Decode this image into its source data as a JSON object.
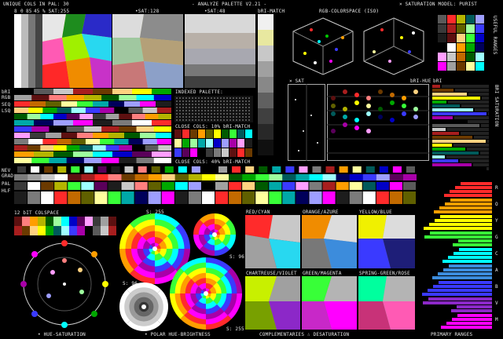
{
  "header": {
    "left": "UNIQUE COLS IN PAL: 30",
    "title": "- ANALYZE PALETTE V2.21 -",
    "right": "× SATURATION MODEL: PURIST"
  },
  "sat_labels": [
    "% SAT:255",
    "•SAT:128",
    "•SAT:48",
    "bRI-MATCH"
  ],
  "small_cols": [
    "8",
    "0",
    "85",
    "45"
  ],
  "rgb_title": "RGB-COLORSPACE (ISO)",
  "side_titles": {
    "useful_ranges": "USEFUL RANGES",
    "saturation": "BRI SATURATION"
  },
  "left_labels": {
    "bri": "bRI",
    "rgb": "RGB",
    "seq": "SEQ",
    "lsq": "LSQ",
    "nev": "NEV",
    "grad": "GRAD",
    "pal": "PAL",
    "hlf": "HLF"
  },
  "indexed_title": "INDEXED PALETTE:",
  "close10_title": "CLOSE COLS: 10% bRI-MATCH",
  "close40_title": "CLOSE COLS: 40% bRI-MATCH",
  "sat_bri": {
    "sat": "× SAT",
    "bri": "bRI-HUE",
    "bri2": "bRI"
  },
  "colspace_title": "12 bIT COLSPACE",
  "polar_labels": [
    "S: 255",
    "S: 96",
    "S: 96",
    "S: 255"
  ],
  "complement_titles": [
    "RED/CYAN",
    "ORANGE/AZURE",
    "YELLOW/BLUE",
    "CHARTREUSE/VIOLET",
    "GREEN/MAGENTA",
    "SPRING-GREEN/ROSE"
  ],
  "primary_letters": [
    "R",
    "O",
    "Y",
    "G",
    "C",
    "A",
    "B",
    "V",
    "M"
  ],
  "footer": {
    "a": "• HUE-SATURATION",
    "b": "• POLAR HUE-BRIGHTNESS",
    "c": "COMPLEMENTARIES ∴ DESATURATION",
    "d": "PRIMARY RANGES"
  },
  "palette": [
    "#000000",
    "#1d1d1d",
    "#3a3a3a",
    "#5a5a5a",
    "#7b7b7b",
    "#a0a0a0",
    "#c8c8c8",
    "#ffffff",
    "#5d1010",
    "#a81e1e",
    "#ff2b2b",
    "#ff7f7f",
    "#6b3a00",
    "#c26a00",
    "#ff9e00",
    "#ffd280",
    "#606000",
    "#b4b400",
    "#ffff00",
    "#ffff9e",
    "#005a00",
    "#00a800",
    "#38ff38",
    "#9eff9e",
    "#005a5a",
    "#00a8a8",
    "#00ffff",
    "#9effff",
    "#00005a",
    "#0000c8",
    "#3a3aff",
    "#9e9eff",
    "#5a005a",
    "#a800a8",
    "#ff00ff",
    "#ff9eff"
  ]
}
